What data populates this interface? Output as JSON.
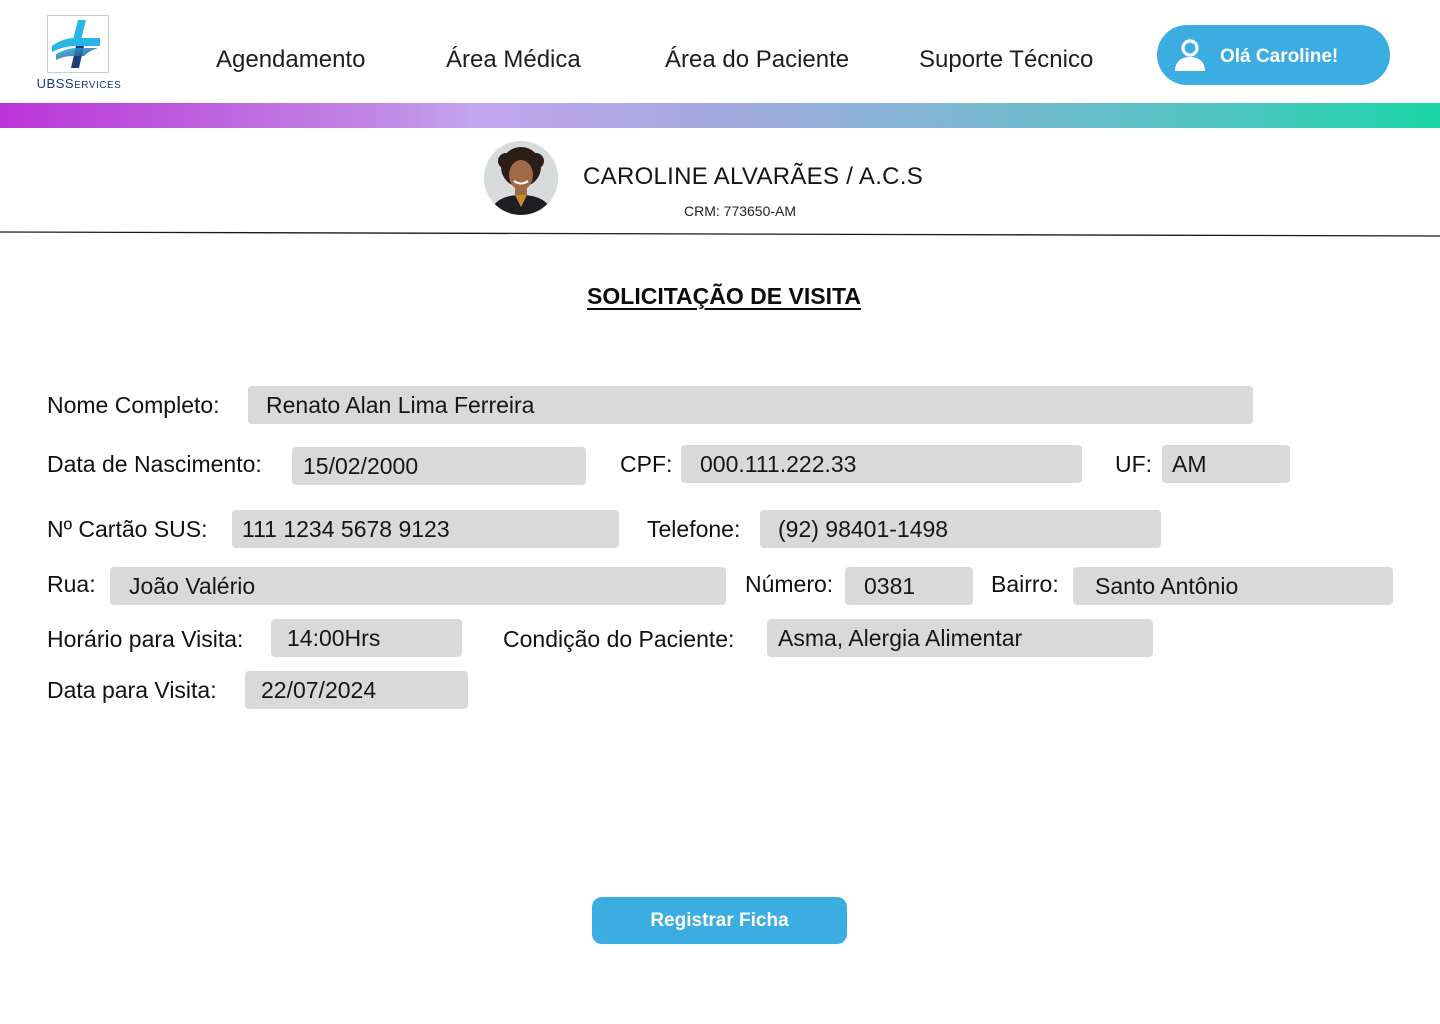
{
  "header": {
    "logo": {
      "brand_main": "UBS",
      "brand_suffix": "ERVICES",
      "brand_cap": "S"
    },
    "nav": [
      {
        "label": "Agendamento"
      },
      {
        "label": "Área Médica"
      },
      {
        "label": "Área do Paciente"
      },
      {
        "label": "Suporte Técnico"
      }
    ],
    "user_button": {
      "label": "Olá Caroline!",
      "icon": "user-icon"
    },
    "accent_color": "#3cade0"
  },
  "profile": {
    "name": "CAROLINE ALVARÃES / A.C.S",
    "crm": "CRM: 773650-AM"
  },
  "form": {
    "title": "SOLICITAÇÃO DE VISITA",
    "fields": {
      "nome_completo": {
        "label": "Nome Completo:",
        "value": "Renato Alan Lima Ferreira"
      },
      "data_nascimento": {
        "label": "Data de Nascimento:",
        "value": "15/02/2000"
      },
      "cpf": {
        "label": "CPF:",
        "value": "000.111.222.33"
      },
      "uf": {
        "label": "UF:",
        "value": "AM"
      },
      "cartao_sus": {
        "label": "Nº Cartão SUS:",
        "value": "111 1234 5678 9123"
      },
      "telefone": {
        "label": "Telefone:",
        "value": "(92) 98401-1498"
      },
      "rua": {
        "label": "Rua:",
        "value": "João Valério"
      },
      "numero": {
        "label": "Número:",
        "value": "0381"
      },
      "bairro": {
        "label": "Bairro:",
        "value": "Santo Antônio"
      },
      "horario_visita": {
        "label": "Horário para Visita:",
        "value": "14:00Hrs"
      },
      "condicao_paciente": {
        "label": "Condição do Paciente:",
        "value": "Asma, Alergia Alimentar"
      },
      "data_visita": {
        "label": "Data para Visita:",
        "value": "22/07/2024"
      }
    },
    "submit_label": "Registrar Ficha"
  }
}
